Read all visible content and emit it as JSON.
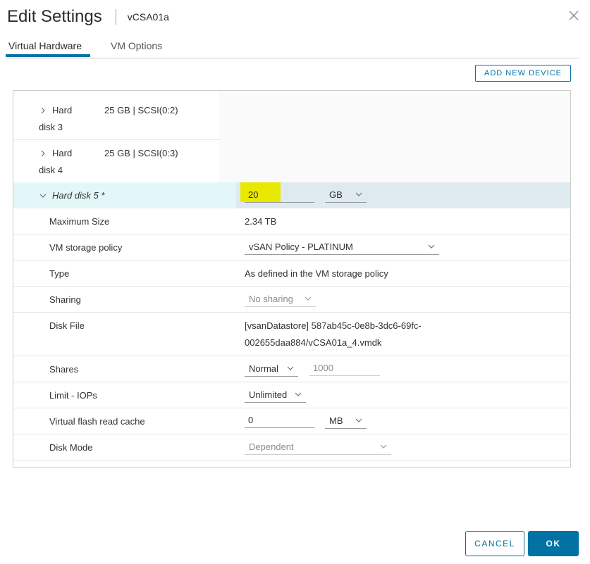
{
  "dialog": {
    "title": "Edit Settings",
    "vm_name": "vCSA01a"
  },
  "tabs": [
    {
      "label": "Virtual Hardware",
      "active": true
    },
    {
      "label": "VM Options",
      "active": false
    }
  ],
  "toolbar": {
    "add_new_device": "ADD NEW DEVICE"
  },
  "devices": [
    {
      "name": "Hard",
      "name_line2": "disk 3",
      "summary": "25 GB | SCSI(0:2)"
    },
    {
      "name": "Hard",
      "name_line2": "disk 4",
      "summary": "25 GB | SCSI(0:3)"
    }
  ],
  "disk5": {
    "name": "Hard disk 5 *",
    "size_value": "20",
    "size_unit": "GB",
    "highlight_color": "#e8e800",
    "rows": {
      "max_size": {
        "label": "Maximum Size",
        "value": "2.34 TB"
      },
      "storage_policy": {
        "label": "VM storage policy",
        "value": "vSAN Policy - PLATINUM"
      },
      "type": {
        "label": "Type",
        "value": "As defined in the VM storage policy"
      },
      "sharing": {
        "label": "Sharing",
        "value": "No sharing"
      },
      "disk_file": {
        "label": "Disk File",
        "value_line1": "[vsanDatastore] 587ab45c-0e8b-3dc6-69fc-",
        "value_line2": "002655daa884/vCSA01a_4.vmdk"
      },
      "shares": {
        "label": "Shares",
        "value": "Normal",
        "amount": "1000"
      },
      "limit_iops": {
        "label": "Limit - IOPs",
        "value": "Unlimited"
      },
      "flash_cache": {
        "label": "Virtual flash read cache",
        "value": "0",
        "unit": "MB"
      },
      "disk_mode": {
        "label": "Disk Mode",
        "value": "Dependent"
      }
    }
  },
  "footer": {
    "cancel": "CANCEL",
    "ok": "OK"
  },
  "colors": {
    "accent": "#0072a3",
    "selected_row": "#dfeaf0",
    "selected_label": "#e3f7f8"
  }
}
